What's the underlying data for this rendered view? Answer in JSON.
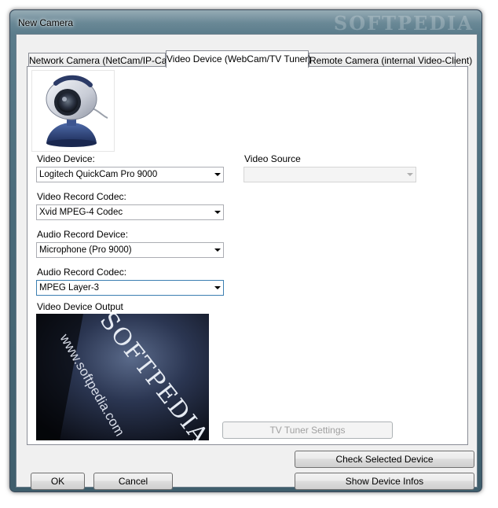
{
  "window": {
    "title": "New Camera",
    "watermark": "SOFTPEDIA"
  },
  "tabs": [
    {
      "label": "Network Camera (NetCam/IP-Cam)",
      "active": false
    },
    {
      "label": "Video Device (WebCam/TV Tuner)",
      "active": true
    },
    {
      "label": "Remote Camera (internal Video-Client)",
      "active": false
    }
  ],
  "form": {
    "video_device": {
      "label": "Video Device:",
      "value": "Logitech QuickCam Pro 9000"
    },
    "video_source": {
      "label": "Video Source",
      "value": ""
    },
    "video_record_codec": {
      "label": "Video Record Codec:",
      "value": "Xvid MPEG-4 Codec"
    },
    "audio_record_device": {
      "label": "Audio Record Device:",
      "value": "Microphone (Pro 9000)"
    },
    "audio_record_codec": {
      "label": "Audio Record Codec:",
      "value": "MPEG Layer-3"
    },
    "video_output": {
      "label": "Video Device Output",
      "overlay_text_1": "www.softpedia.com",
      "overlay_text_2": "SOFTPEDIA"
    },
    "tv_tuner_settings_label": "TV Tuner Settings"
  },
  "buttons": {
    "check_selected_device": "Check Selected Device",
    "show_device_infos": "Show Device Infos",
    "ok": "OK",
    "cancel": "Cancel"
  },
  "icons": {
    "webcam": "webcam-icon",
    "dropdown": "chevron-down-icon"
  },
  "colors": {
    "window_frame": "#4a6b7a",
    "client_bg": "#f0f0f0",
    "panel_bg": "#ffffff",
    "disabled_text": "#a0a0a0"
  }
}
